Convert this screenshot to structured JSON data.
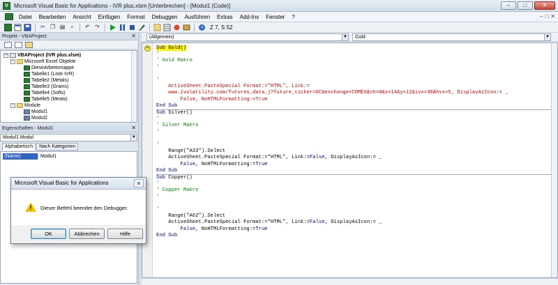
{
  "window": {
    "title": "Microsoft Visual Basic for Applications - IVR plus.xlsm [Unterbrechen] - [Modul1 (Code)]",
    "controls": {
      "minimize": "–",
      "maximize": "□",
      "close": "✕"
    }
  },
  "menu": {
    "items": [
      "Datei",
      "Bearbeiten",
      "Ansicht",
      "Einfügen",
      "Format",
      "Debuggen",
      "Ausführen",
      "Extras",
      "Add-Ins",
      "Fenster",
      "?"
    ],
    "mdi_controls": [
      "–",
      "□",
      "✕"
    ]
  },
  "toolbar": {
    "position": "Z 7, S 52"
  },
  "project_panel": {
    "title": "Projekt - VBAProject",
    "close": "✕",
    "tree": [
      {
        "label": "VBAProject (IVR plus.xlsm)",
        "level": 0,
        "expander": "−",
        "icon": "project",
        "bold": true
      },
      {
        "label": "Microsoft Excel Objekte",
        "level": 1,
        "expander": "−",
        "icon": "folder"
      },
      {
        "label": "DieseArbeitsmappe",
        "level": 2,
        "expander": "",
        "icon": "excel"
      },
      {
        "label": "Tabelle1 (Liste IVR)",
        "level": 2,
        "expander": "",
        "icon": "excel"
      },
      {
        "label": "Tabelle2 (Metals)",
        "level": 2,
        "expander": "",
        "icon": "excel"
      },
      {
        "label": "Tabelle3 (Grains)",
        "level": 2,
        "expander": "",
        "icon": "excel"
      },
      {
        "label": "Tabelle4 (Softs)",
        "level": 2,
        "expander": "",
        "icon": "excel"
      },
      {
        "label": "Tabelle5 (Meats)",
        "level": 2,
        "expander": "",
        "icon": "excel"
      },
      {
        "label": "Module",
        "level": 1,
        "expander": "−",
        "icon": "folder"
      },
      {
        "label": "Modul1",
        "level": 2,
        "expander": "",
        "icon": "module"
      },
      {
        "label": "Modul2",
        "level": 2,
        "expander": "",
        "icon": "module"
      }
    ]
  },
  "properties_panel": {
    "title": "Eigenschaften - Modul1",
    "close": "✕",
    "object_combo": "Modul1 Modul",
    "tabs": [
      "Alphabetisch",
      "Nach Kategorien"
    ],
    "rows": [
      {
        "key": "(Name)",
        "value": "Modul1"
      }
    ]
  },
  "code_window": {
    "object_combo": "(Allgemein)",
    "procedure_combo": "Gold",
    "exec_marker": "⇨"
  },
  "dialog": {
    "title": "Microsoft Visual Basic for Applications",
    "close": "✕",
    "message": "Dieser Befehl beendet den Debugger.",
    "buttons": [
      "OK",
      "Abbrechen",
      "Hilfe"
    ]
  }
}
